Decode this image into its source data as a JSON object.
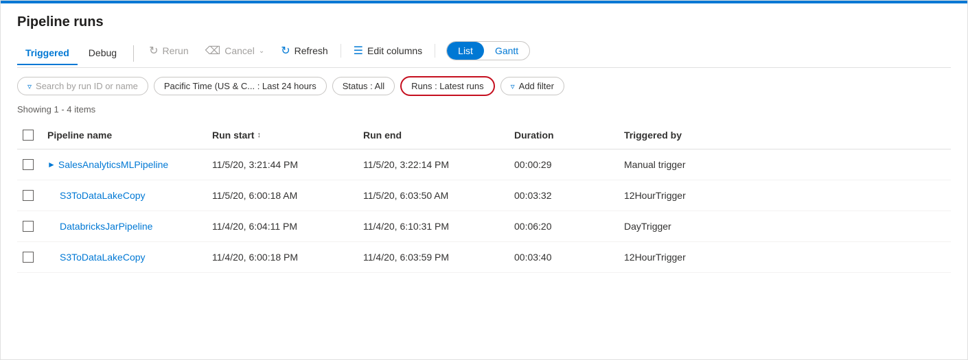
{
  "page": {
    "title": "Pipeline runs",
    "top_bar_color": "#0078d4"
  },
  "tabs": [
    {
      "id": "triggered",
      "label": "Triggered",
      "active": true
    },
    {
      "id": "debug",
      "label": "Debug",
      "active": false
    }
  ],
  "toolbar": {
    "rerun_label": "Rerun",
    "cancel_label": "Cancel",
    "refresh_label": "Refresh",
    "edit_columns_label": "Edit columns",
    "list_label": "List",
    "gantt_label": "Gantt"
  },
  "filters": {
    "search_placeholder": "Search by run ID or name",
    "time_filter": "Pacific Time (US & C... : Last 24 hours",
    "status_filter": "Status : All",
    "runs_filter": "Runs : Latest runs",
    "add_filter_label": "Add filter"
  },
  "showing_text": "Showing 1 - 4 items",
  "columns": [
    {
      "id": "pipeline_name",
      "label": "Pipeline name"
    },
    {
      "id": "run_start",
      "label": "Run start",
      "sortable": true
    },
    {
      "id": "run_end",
      "label": "Run end"
    },
    {
      "id": "duration",
      "label": "Duration"
    },
    {
      "id": "triggered_by",
      "label": "Triggered by"
    }
  ],
  "rows": [
    {
      "id": "row1",
      "pipeline_name": "SalesAnalyticsMLPipeline",
      "expandable": true,
      "run_start": "11/5/20, 3:21:44 PM",
      "run_end": "11/5/20, 3:22:14 PM",
      "duration": "00:00:29",
      "triggered_by": "Manual trigger"
    },
    {
      "id": "row2",
      "pipeline_name": "S3ToDataLakeCopy",
      "expandable": false,
      "run_start": "11/5/20, 6:00:18 AM",
      "run_end": "11/5/20, 6:03:50 AM",
      "duration": "00:03:32",
      "triggered_by": "12HourTrigger"
    },
    {
      "id": "row3",
      "pipeline_name": "DatabricksJarPipeline",
      "expandable": false,
      "run_start": "11/4/20, 6:04:11 PM",
      "run_end": "11/4/20, 6:10:31 PM",
      "duration": "00:06:20",
      "triggered_by": "DayTrigger"
    },
    {
      "id": "row4",
      "pipeline_name": "S3ToDataLakeCopy",
      "expandable": false,
      "run_start": "11/4/20, 6:00:18 PM",
      "run_end": "11/4/20, 6:03:59 PM",
      "duration": "00:03:40",
      "triggered_by": "12HourTrigger"
    }
  ]
}
